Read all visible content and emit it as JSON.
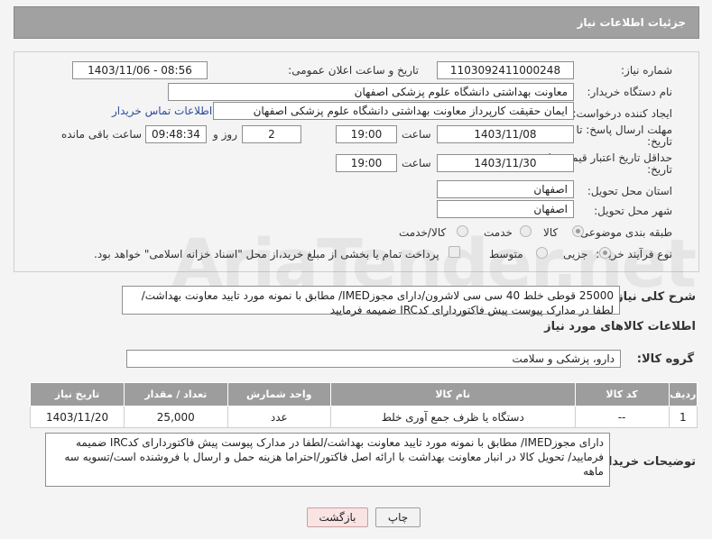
{
  "header": {
    "title": "جزئیات اطلاعات نیاز"
  },
  "form": {
    "need_number_label": "شماره نیاز:",
    "need_number": "1103092411000248",
    "announce_label": "تاریخ و ساعت اعلان عمومی:",
    "announce_value": "1403/11/06 - 08:56",
    "buyer_org_label": "نام دستگاه خریدار:",
    "buyer_org": "معاونت بهداشتی دانشگاه علوم پزشکی اصفهان",
    "requester_label": "ایجاد کننده درخواست:",
    "requester": "ایمان حقیقت کارپرداز معاونت بهداشتی دانشگاه علوم پزشکی اصفهان",
    "buyer_contact_link": "اطلاعات تماس خریدار",
    "send_deadline_label_1": "مهلت ارسال پاسخ: تا",
    "send_deadline_label_2": "تاریخ:",
    "send_deadline_date": "1403/11/08",
    "hour_label": "ساعت",
    "send_deadline_time": "19:00",
    "days_value": "2",
    "days_label": "روز و",
    "remaining_time": "09:48:34",
    "remaining_label": "ساعت باقی مانده",
    "validity_label_1": "حداقل تاریخ اعتبار قیمت: تا",
    "validity_label_2": "تاریخ:",
    "validity_date": "1403/11/30",
    "validity_hour_label": "ساعت",
    "validity_time": "19:00",
    "province_label": "استان محل تحویل:",
    "province": "اصفهان",
    "city_label": "شهر محل تحویل:",
    "city": "اصفهان",
    "category_label": "طبقه بندی موضوعی:",
    "category_goods": "کالا",
    "category_service": "خدمت",
    "category_goods_service": "کالا/خدمت",
    "process_label": "نوع فرآیند خرید :",
    "process_small": "جزیی",
    "process_medium": "متوسط",
    "process_note": "پرداخت تمام یا بخشی از مبلغ خرید،از محل \"اسناد خزانه اسلامی\" خواهد بود."
  },
  "description": {
    "label": "شرح کلی نیاز:",
    "text": "25000 قوطی خلط 40 سی سی لاشرون/دارای مجوزIMED/ مطابق با نمونه مورد تایید معاونت بهداشت/لطفا در مدارک پیوست پیش فاکتوردارای کدIRC ضمیمه فرمایید"
  },
  "goods_info": {
    "title": "اطلاعات کالاهای مورد نیاز",
    "group_label": "گروه کالا:",
    "group_value": "دارو، پزشکی و سلامت"
  },
  "table": {
    "headers": [
      "ردیف",
      "کد کالا",
      "نام کالا",
      "واحد شمارش",
      "تعداد / مقدار",
      "تاریخ نیاز"
    ],
    "rows": [
      [
        "1",
        "--",
        "دستگاه یا ظرف جمع آوری خلط",
        "عدد",
        "25,000",
        "1403/11/20"
      ]
    ]
  },
  "buyer_notes": {
    "label": "توضیحات خریدار:",
    "text": "دارای مجوزIMED/ مطابق با نمونه مورد تایید معاونت بهداشت/لطفا در مدارک پیوست پیش فاکتوردارای کدIRC ضمیمه فرمایید/ تحویل کالا در انبار معاونت بهداشت با ارائه اصل فاکتور/احتراما هزینه حمل و ارسال با فروشنده است/تسویه سه ماهه"
  },
  "buttons": {
    "print": "چاپ",
    "back": "بازگشت"
  },
  "colors": {
    "header_bg": "#a1a1a1",
    "table_header_bg": "#9d9d9d",
    "link": "#2a4d9b",
    "back_button_bg": "#f9e3e3"
  }
}
